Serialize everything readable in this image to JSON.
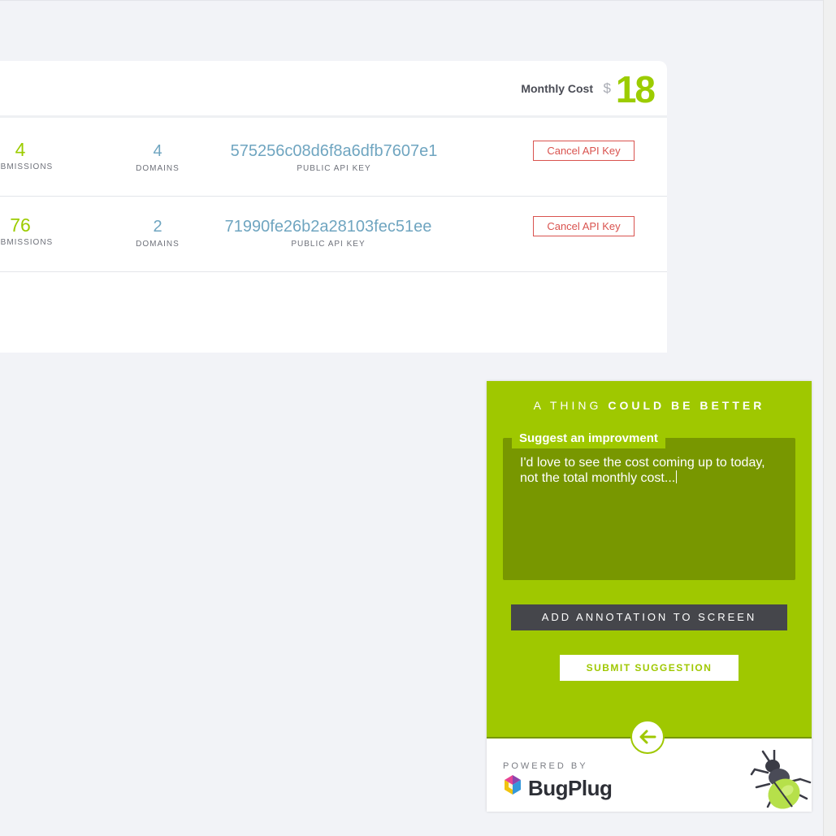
{
  "header": {
    "monthly_cost_label": "Monthly Cost",
    "currency": "$",
    "monthly_cost_value": "18"
  },
  "api_keys": [
    {
      "submissions": "4",
      "submissions_label": "SUBMISSIONS",
      "domains": "4",
      "domains_label": "DOMAINS",
      "key": "575256c08d6f8a6dfb7607e1",
      "key_label": "PUBLIC API KEY",
      "cancel_label": "Cancel API Key"
    },
    {
      "submissions": "76",
      "submissions_label": "SUBMISSIONS",
      "domains": "2",
      "domains_label": "DOMAINS",
      "key": "71990fe26b2a28103fec51ee",
      "key_label": "PUBLIC API KEY",
      "cancel_label": "Cancel API Key"
    }
  ],
  "widget": {
    "title_light": "A THING ",
    "title_bold": "COULD BE BETTER",
    "field_label": "Suggest an improvment",
    "field_value": "I'd love to see the cost coming up to today, not the total monthly cost...",
    "annotate_label": "ADD ANNOTATION TO SCREEN",
    "submit_label": "SUBMIT SUGGESTION",
    "powered_by": "POWERED BY",
    "brand": "BugPlug",
    "back_icon": "arrow-left-icon",
    "accent_color": "#9fc800"
  }
}
